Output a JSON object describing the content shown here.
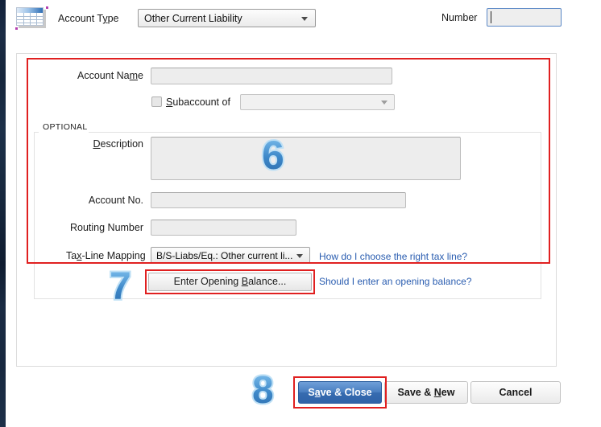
{
  "window": {
    "icon": "spreadsheet-grid-icon"
  },
  "topbar": {
    "account_type_label_pre": "Account T",
    "account_type_label_mnemonic": "y",
    "account_type_label_post": "pe",
    "account_type_value": "Other Current Liability",
    "number_label": "Number",
    "number_value": ""
  },
  "form": {
    "account_name": {
      "label_pre": "Account Na",
      "label_mnemonic": "m",
      "label_post": "e",
      "value": ""
    },
    "subaccount": {
      "label_mnemonic": "S",
      "label_post": "ubaccount of",
      "checked": false,
      "value": ""
    },
    "optional_legend": "OPTIONAL",
    "description": {
      "label_mnemonic": "D",
      "label_post": "escription",
      "value": ""
    },
    "account_no": {
      "label": "Account No.",
      "value": ""
    },
    "routing_number": {
      "label": "Routing Number",
      "value": ""
    },
    "tax_line_mapping": {
      "label_pre": "Ta",
      "label_mnemonic": "x",
      "label_post": "-Line Mapping",
      "value": "B/S-Liabs/Eq.: Other current li...",
      "help_link": "How do I choose the right tax line?"
    },
    "opening_balance": {
      "button_pre": "Enter Opening ",
      "button_mnemonic": "B",
      "button_post": "alance...",
      "help_link": "Should I enter an opening balance?"
    }
  },
  "actions": {
    "save_close_pre": "S",
    "save_close_mnemonic": "a",
    "save_close_post": "ve & Close",
    "save_new_pre": "Save & ",
    "save_new_mnemonic": "N",
    "save_new_post": "ew",
    "cancel": "Cancel"
  },
  "annotations": {
    "step6": "6",
    "step7": "7",
    "step8": "8"
  },
  "colors": {
    "annotation_red": "#e02020",
    "annotation_blue": "#3d88c9",
    "primary_button": "#366bb0",
    "link": "#2a5db0",
    "sidebar": "#16263c"
  }
}
